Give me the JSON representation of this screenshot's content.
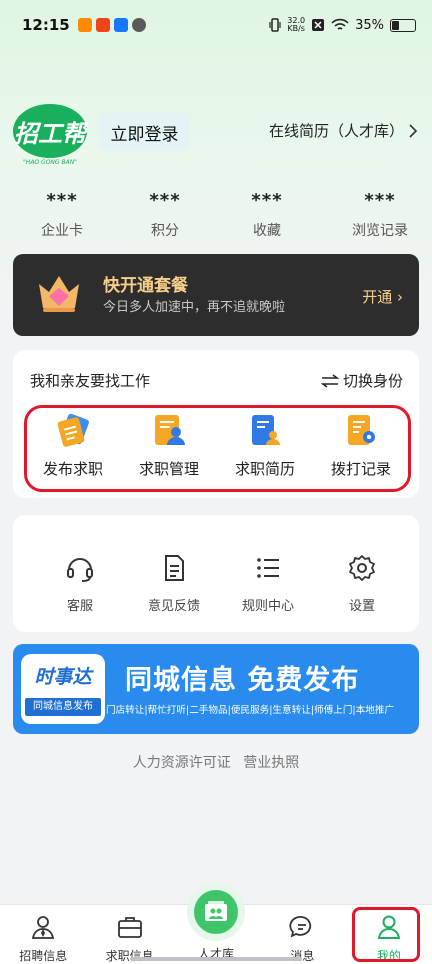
{
  "status_bar": {
    "time": "12:15",
    "net_speed_top": "32.0",
    "net_speed_bottom": "KB/s",
    "battery": "35%",
    "battery_level": 0.35
  },
  "header": {
    "logo_text": "招工帮",
    "logo_subtitle": "\"HAO GONG BAN\"",
    "login_button": "立即登录",
    "resume_link": "在线简历（人才库）"
  },
  "stats": [
    {
      "value": "***",
      "label": "企业卡"
    },
    {
      "value": "***",
      "label": "积分"
    },
    {
      "value": "***",
      "label": "收藏"
    },
    {
      "value": "***",
      "label": "浏览记录"
    }
  ],
  "vip": {
    "title": "快开通套餐",
    "subtitle": "今日多人加速中，再不追就晚啦",
    "action": "开通"
  },
  "job_section": {
    "title": "我和亲友要找工作",
    "switch_label": "切换身份",
    "items": [
      {
        "label": "发布求职",
        "icon": "publish-job-icon"
      },
      {
        "label": "求职管理",
        "icon": "job-management-icon"
      },
      {
        "label": "求职简历",
        "icon": "resume-icon"
      },
      {
        "label": "拨打记录",
        "icon": "call-record-icon"
      }
    ]
  },
  "tools": [
    {
      "label": "客服",
      "icon": "headset-icon"
    },
    {
      "label": "意见反馈",
      "icon": "feedback-icon"
    },
    {
      "label": "规则中心",
      "icon": "list-icon"
    },
    {
      "label": "设置",
      "icon": "gear-icon"
    }
  ],
  "banner": {
    "badge_title": "时事达",
    "badge_subtitle": "同城信息发布",
    "headline": "同城信息 免费发布",
    "tagline": "门店转让|帮忙打听|二手物品|便民服务|生意转让|师傅上门|本地推广"
  },
  "footer_links": {
    "license": "人力资源许可证",
    "business": "营业执照"
  },
  "tabbar": [
    {
      "label": "招聘信息",
      "icon": "recruit-icon"
    },
    {
      "label": "求职信息",
      "icon": "briefcase-icon"
    },
    {
      "label": "人才库",
      "icon": "talent-pool-icon"
    },
    {
      "label": "消息",
      "icon": "message-icon"
    },
    {
      "label": "我的",
      "icon": "user-icon",
      "active": true
    }
  ],
  "colors": {
    "brand_green": "#1aaf5d",
    "accent_blue": "#2a8bee",
    "highlight_red": "#e0192a",
    "vip_gold": "#f6cf8a"
  }
}
